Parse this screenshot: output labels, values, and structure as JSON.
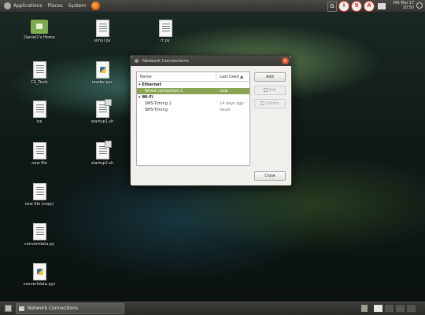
{
  "top_panel": {
    "menus": [
      "Applications",
      "Places",
      "System"
    ],
    "tray": {
      "box_label": "G",
      "circle_labels": [
        "I",
        "9",
        "A"
      ]
    },
    "clock": {
      "day": "Mit Mai 17",
      "time": "10:50"
    }
  },
  "desktop": {
    "icons": [
      {
        "label": "Daniel2's Home"
      },
      {
        "label": "simul.py"
      },
      {
        "label": "rt.py"
      },
      {
        "label": "CS_Tools"
      },
      {
        "label": "reader.pyc"
      },
      {
        "label": "ice"
      },
      {
        "label": "startup1.sh"
      },
      {
        "label": "new file"
      },
      {
        "label": "startup2.sh"
      },
      {
        "label": "new file (copy)"
      },
      {
        "label": "convertdata.py"
      },
      {
        "label": "convertdata.pyc"
      }
    ]
  },
  "window": {
    "title": "Network Connections",
    "close_glyph": "×",
    "columns": {
      "name": "Name",
      "last_used": "Last Used ▲"
    },
    "groups": [
      {
        "label": "Ethernet",
        "rows": [
          {
            "name": "Wired connection 1",
            "last_used": "now"
          }
        ]
      },
      {
        "label": "Wi-Fi",
        "rows": [
          {
            "name": "SMS-Timing 1",
            "last_used": "14 days ago"
          },
          {
            "name": "SMS-Timing",
            "last_used": "never"
          }
        ]
      }
    ],
    "buttons": {
      "add": "Add",
      "edit": "Edit",
      "delete": "Delete",
      "close": "Close"
    }
  },
  "taskbar": {
    "task_label": "Network Connections"
  }
}
